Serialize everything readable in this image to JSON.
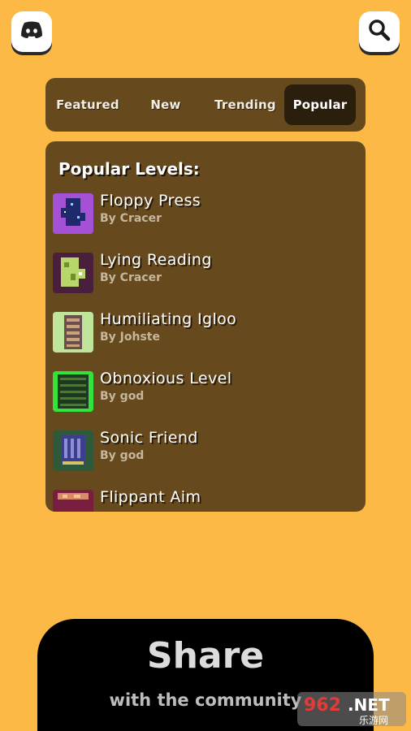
{
  "header": {
    "discord_icon": "discord-icon",
    "search_icon": "search-icon"
  },
  "tabs": [
    {
      "label": "Featured",
      "active": false
    },
    {
      "label": "New",
      "active": false
    },
    {
      "label": "Trending",
      "active": false
    },
    {
      "label": "Popular",
      "active": true
    }
  ],
  "panel": {
    "title": "Popular Levels:"
  },
  "levels": [
    {
      "name": "Floppy Press",
      "author": "By Cracer",
      "thumb_color": "#A551D6"
    },
    {
      "name": "Lying Reading",
      "author": "By Cracer",
      "thumb_color": "#4A1F3B"
    },
    {
      "name": "Humiliating Igloo",
      "author": "By Johste",
      "thumb_color": "#BFE59A"
    },
    {
      "name": "Obnoxious Level",
      "author": "By god",
      "thumb_color": "#34E23E"
    },
    {
      "name": "Sonic Friend",
      "author": "By god",
      "thumb_color": "#2F5A3A"
    },
    {
      "name": "Flippant Aim",
      "author": "",
      "thumb_color": "#7A1E40"
    }
  ],
  "share": {
    "title": "Share",
    "subtitle": "with the community"
  },
  "watermark": {
    "text_main": "962.NET",
    "text_sub": "乐游网"
  },
  "colors": {
    "background": "#FDB945",
    "panel": "#664A1E",
    "active_tab": "#2A1E0C",
    "share_bg": "#000000"
  }
}
